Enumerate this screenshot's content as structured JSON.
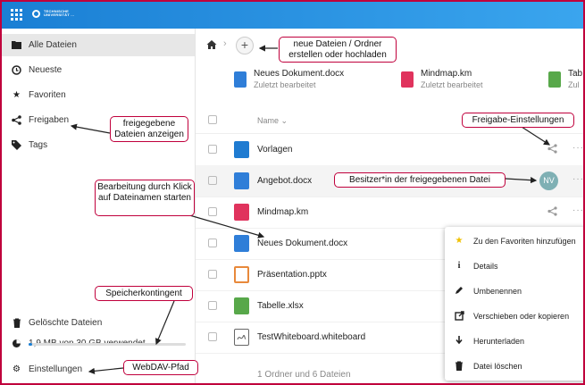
{
  "header": {
    "logo_text": "TECHNISCHE UNIVERSITÄT …"
  },
  "sidebar": {
    "items": [
      {
        "label": "Alle Dateien",
        "icon": "folder-icon"
      },
      {
        "label": "Neueste",
        "icon": "clock-icon"
      },
      {
        "label": "Favoriten",
        "icon": "star-icon"
      },
      {
        "label": "Freigaben",
        "icon": "share-icon"
      },
      {
        "label": "Tags",
        "icon": "tag-icon"
      }
    ],
    "bottom": {
      "deleted": "Gelöschte Dateien",
      "quota": "1,9 MB von 30 GB verwendet",
      "quota_fraction": 0.02,
      "settings": "Einstellungen"
    }
  },
  "breadcrumb": {
    "home_icon": "home-icon",
    "add_icon": "+"
  },
  "recent": [
    {
      "name": "Neues Dokument.docx",
      "sub": "Zuletzt bearbeitet",
      "icon": "document-icon"
    },
    {
      "name": "Mindmap.km",
      "sub": "Zuletzt bearbeitet",
      "icon": "mindmap-icon"
    },
    {
      "name": "Tab",
      "sub": "Zul",
      "icon": "spreadsheet-icon"
    }
  ],
  "table": {
    "header_name": "Name ⌄",
    "rows": [
      {
        "name": "Vorlagen",
        "icon": "folder-icon"
      },
      {
        "name": "Angebot.docx",
        "icon": "document-icon",
        "owner": "NV"
      },
      {
        "name": "Mindmap.km",
        "icon": "mindmap-icon"
      },
      {
        "name": "Neues Dokument.docx",
        "icon": "document-icon"
      },
      {
        "name": "Präsentation.pptx",
        "icon": "presentation-icon"
      },
      {
        "name": "Tabelle.xlsx",
        "icon": "spreadsheet-icon"
      },
      {
        "name": "TestWhiteboard.whiteboard",
        "icon": "whiteboard-icon"
      }
    ],
    "footer": "1 Ordner und 6 Dateien"
  },
  "menu": [
    {
      "label": "Zu den Favoriten hinzufügen",
      "icon": "star-icon"
    },
    {
      "label": "Details",
      "icon": "info-icon"
    },
    {
      "label": "Umbenennen",
      "icon": "pencil-icon"
    },
    {
      "label": "Verschieben oder kopieren",
      "icon": "move-icon"
    },
    {
      "label": "Herunterladen",
      "icon": "download-icon"
    },
    {
      "label": "Datei löschen",
      "icon": "trash-icon"
    }
  ],
  "callouts": {
    "new_files": "neue Dateien / Ordner erstellen oder hochladen",
    "shared": "freigegebene Dateien anzeigen",
    "share_settings": "Freigabe-Einstellungen",
    "owner": "Besitzer*in der freigegebenen Datei",
    "edit": "Bearbeitung durch Klick auf Dateinamen starten",
    "quota": "Speicherkontingent",
    "webdav": "WebDAV-Pfad"
  },
  "colors": {
    "accent": "#1a7fd4",
    "callout_border": "#c0003c",
    "avatar": "#7fb0b4"
  }
}
